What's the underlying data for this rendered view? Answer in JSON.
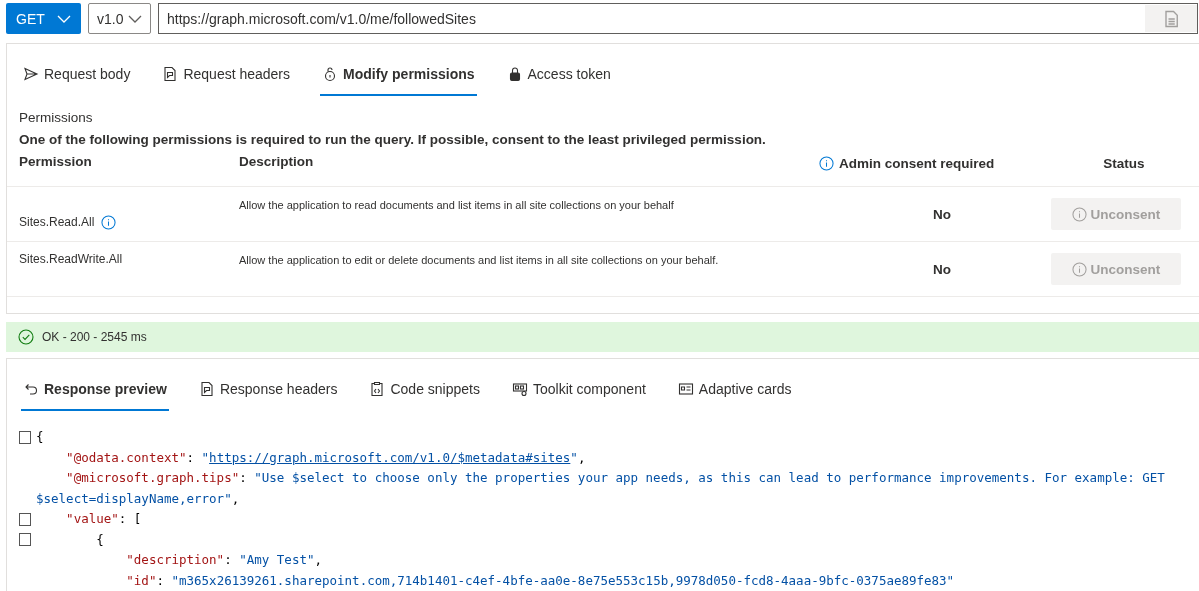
{
  "query_bar": {
    "method": "GET",
    "version": "v1.0",
    "url": "https://graph.microsoft.com/v1.0/me/followedSites"
  },
  "request_tabs": [
    {
      "label": "Request body",
      "selected": false
    },
    {
      "label": "Request headers",
      "selected": false
    },
    {
      "label": "Modify permissions",
      "selected": true
    },
    {
      "label": "Access token",
      "selected": false
    }
  ],
  "permissions": {
    "title": "Permissions",
    "note": "One of the following permissions is required to run the query. If possible, consent to the least privileged permission.",
    "columns": [
      "Permission",
      "Description",
      "Admin consent required",
      "Status"
    ],
    "rows": [
      {
        "name": "Sites.Read.All",
        "info": true,
        "description": "Allow the application to read documents and list items in all site collections on your behalf",
        "admin": "No",
        "action": "Unconsent",
        "disabled": true
      },
      {
        "name": "Sites.ReadWrite.All",
        "info": false,
        "description": "Allow the application to edit or delete documents and list items in all site collections on your behalf.",
        "admin": "No",
        "action": "Unconsent",
        "disabled": true
      }
    ]
  },
  "status_bar": {
    "text": "OK - 200 - 2545 ms",
    "kind": "success"
  },
  "response_tabs": [
    {
      "label": "Response preview",
      "selected": true
    },
    {
      "label": "Response headers",
      "selected": false
    },
    {
      "label": "Code snippets",
      "selected": false
    },
    {
      "label": "Toolkit component",
      "selected": false
    },
    {
      "label": "Adaptive cards",
      "selected": false
    }
  ],
  "response_lines": [
    {
      "fold": true,
      "tokens": [
        {
          "kind": "punct",
          "text": "{"
        }
      ]
    },
    {
      "fold": false,
      "tokens": [
        {
          "kind": "key",
          "text": "    \"@odata.context\""
        },
        {
          "kind": "punct",
          "text": ": "
        },
        {
          "kind": "string",
          "text": "\""
        },
        {
          "kind": "link",
          "text": "https://graph.microsoft.com/v1.0/$metadata#sites"
        },
        {
          "kind": "string",
          "text": "\""
        },
        {
          "kind": "punct",
          "text": ","
        }
      ]
    },
    {
      "fold": false,
      "tokens": [
        {
          "kind": "key",
          "text": "    \"@microsoft.graph.tips\""
        },
        {
          "kind": "punct",
          "text": ": "
        },
        {
          "kind": "string",
          "text": "\"Use $select to choose only the properties your app needs, as this can lead to performance improvements. For example: GET"
        }
      ]
    },
    {
      "fold": false,
      "tokens": [
        {
          "kind": "string",
          "text": "$select=displayName,error\""
        },
        {
          "kind": "punct",
          "text": ","
        }
      ]
    },
    {
      "fold": true,
      "tokens": [
        {
          "kind": "key",
          "text": "    \"value\""
        },
        {
          "kind": "punct",
          "text": ": ["
        }
      ]
    },
    {
      "fold": true,
      "tokens": [
        {
          "kind": "punct",
          "text": "        {"
        }
      ]
    },
    {
      "fold": false,
      "tokens": [
        {
          "kind": "key",
          "text": "            \"description\""
        },
        {
          "kind": "punct",
          "text": ": "
        },
        {
          "kind": "string",
          "text": "\"Amy Test\""
        },
        {
          "kind": "punct",
          "text": ","
        }
      ]
    },
    {
      "fold": false,
      "tokens": [
        {
          "kind": "key",
          "text": "            \"id\""
        },
        {
          "kind": "punct",
          "text": ": "
        },
        {
          "kind": "string",
          "text": "\"m365x26139261.sharepoint.com,714b1401-c4ef-4bfe-aa0e-8e75e553c15b,9978d050-fcd8-4aaa-9bfc-0375ae89fe83\""
        }
      ]
    }
  ]
}
